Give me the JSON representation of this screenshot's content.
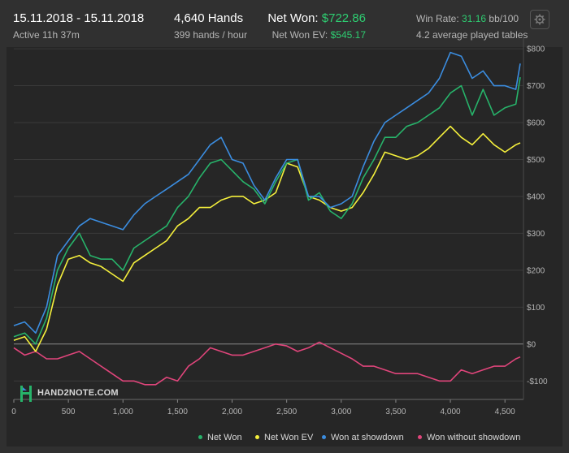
{
  "header": {
    "date_range": "15.11.2018 - 15.11.2018",
    "active": "Active 11h 37m",
    "hands": "4,640 Hands",
    "hands_per_hour": "399 hands / hour",
    "net_won_label": "Net Won:",
    "net_won_value": "$722.86",
    "net_won_ev_label": "Net Won  EV:",
    "net_won_ev_value": "$545.17",
    "win_rate_label": "Win Rate:",
    "win_rate_value": "31.16",
    "win_rate_unit": "bb/100",
    "avg_tables": "4.2 average played tables"
  },
  "logo": {
    "text": "HAND2NOTE.COM"
  },
  "chart_data": {
    "type": "line",
    "xlim": [
      0,
      4640
    ],
    "ylim": [
      -150,
      820
    ],
    "xticks": [
      0,
      500,
      1000,
      1500,
      2000,
      2500,
      3000,
      3500,
      4000,
      4500
    ],
    "xtick_labels": [
      "0",
      "500",
      "1,000",
      "1,500",
      "2,000",
      "2,500",
      "3,000",
      "3,500",
      "4,000",
      "4,500"
    ],
    "yticks": [
      -100,
      0,
      100,
      200,
      300,
      400,
      500,
      600,
      700,
      800
    ],
    "ytick_labels": [
      "-$100",
      "$0",
      "$100",
      "$200",
      "$300",
      "$400",
      "$500",
      "$600",
      "$700",
      "$800"
    ],
    "legend_position": "bottom",
    "x": [
      0,
      100,
      200,
      300,
      400,
      500,
      600,
      700,
      800,
      900,
      1000,
      1100,
      1200,
      1300,
      1400,
      1500,
      1600,
      1700,
      1800,
      1900,
      2000,
      2100,
      2200,
      2300,
      2400,
      2500,
      2600,
      2700,
      2800,
      2900,
      3000,
      3100,
      3200,
      3300,
      3400,
      3500,
      3600,
      3700,
      3800,
      3900,
      4000,
      4100,
      4200,
      4300,
      4400,
      4500,
      4600,
      4640
    ],
    "series": [
      {
        "name": "Net Won",
        "color": "#27b36a",
        "values": [
          20,
          30,
          0,
          70,
          200,
          260,
          300,
          240,
          230,
          230,
          200,
          260,
          280,
          300,
          320,
          370,
          400,
          450,
          490,
          500,
          470,
          440,
          420,
          380,
          440,
          490,
          500,
          390,
          410,
          360,
          340,
          380,
          450,
          500,
          560,
          560,
          590,
          600,
          620,
          640,
          680,
          700,
          620,
          690,
          620,
          640,
          650,
          723
        ]
      },
      {
        "name": "Net Won  EV",
        "color": "#f5f03c",
        "values": [
          10,
          20,
          -20,
          40,
          160,
          230,
          240,
          220,
          210,
          190,
          170,
          220,
          240,
          260,
          280,
          320,
          340,
          370,
          370,
          390,
          400,
          400,
          380,
          390,
          410,
          490,
          480,
          400,
          390,
          370,
          360,
          370,
          410,
          460,
          520,
          510,
          500,
          510,
          530,
          560,
          590,
          560,
          540,
          570,
          540,
          520,
          540,
          545
        ]
      },
      {
        "name": "Won at showdown",
        "color": "#3b8de0",
        "values": [
          50,
          60,
          30,
          100,
          240,
          280,
          320,
          340,
          330,
          320,
          310,
          350,
          380,
          400,
          420,
          440,
          460,
          500,
          540,
          560,
          500,
          490,
          430,
          390,
          450,
          500,
          500,
          400,
          400,
          370,
          380,
          400,
          480,
          550,
          600,
          620,
          640,
          660,
          680,
          720,
          790,
          780,
          720,
          740,
          700,
          700,
          690,
          760
        ]
      },
      {
        "name": "Won without showdown",
        "color": "#e0457b",
        "values": [
          -10,
          -30,
          -20,
          -40,
          -40,
          -30,
          -20,
          -40,
          -60,
          -80,
          -100,
          -100,
          -110,
          -110,
          -90,
          -100,
          -60,
          -40,
          -10,
          -20,
          -30,
          -30,
          -20,
          -10,
          0,
          -5,
          -20,
          -10,
          5,
          -10,
          -25,
          -40,
          -60,
          -60,
          -70,
          -80,
          -80,
          -80,
          -90,
          -100,
          -100,
          -70,
          -80,
          -70,
          -60,
          -60,
          -40,
          -35
        ]
      }
    ]
  }
}
